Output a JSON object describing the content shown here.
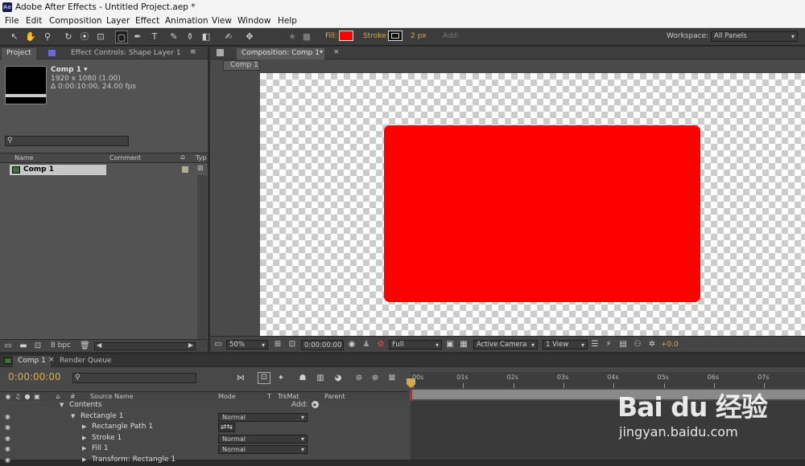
{
  "window": {
    "title": "Adobe After Effects - Untitled Project.aep *",
    "app_icon": "Ae"
  },
  "menu": [
    "File",
    "Edit",
    "Composition",
    "Layer",
    "Effect",
    "Animation",
    "View",
    "Window",
    "Help"
  ],
  "toolbar": {
    "fill_label": "Fill:",
    "fill_color": "#ff0000",
    "stroke_label": "Stroke:",
    "stroke_width": "2 px",
    "add_label": "Add:",
    "workspace_label": "Workspace:",
    "workspace_value": "All Panels"
  },
  "project_panel": {
    "tabs": [
      "Project",
      "Effect Controls: Shape Layer 1"
    ],
    "comp_name": "Comp 1 ▾",
    "comp_size": "1920 x 1080 (1.00)",
    "comp_duration": "Δ 0:00:10:00, 24.00 fps",
    "columns": {
      "name": "Name",
      "comment": "Comment",
      "type": "Typ"
    },
    "items": [
      {
        "name": "Comp 1"
      }
    ],
    "bpc": "8 bpc"
  },
  "comp_panel": {
    "tab": "Composition: Comp 1",
    "sub_tab": "Comp 1",
    "shape_color": "#ff0000",
    "zoom": "50%",
    "timecode": "0:00:00:00",
    "resolution": "Full",
    "camera": "Active Camera",
    "views": "1 View",
    "exposure": "+0.0"
  },
  "timeline": {
    "tabs": [
      "Comp 1",
      "Render Queue"
    ],
    "timecode": "0:00:00:00",
    "columns": {
      "source": "Source Name",
      "mode": "Mode",
      "t": "T",
      "trkmat": "TrkMat",
      "parent": "Parent"
    },
    "ruler": [
      "00s",
      "01s",
      "02s",
      "03s",
      "04s",
      "05s",
      "06s",
      "07s"
    ],
    "add_label": "Add:",
    "layers": [
      {
        "indent": 1,
        "name": "Contents",
        "mode": ""
      },
      {
        "indent": 2,
        "name": "Rectangle 1",
        "mode": "Normal"
      },
      {
        "indent": 3,
        "name": "Rectangle Path 1",
        "mode": ""
      },
      {
        "indent": 3,
        "name": "Stroke 1",
        "mode": "Normal"
      },
      {
        "indent": 3,
        "name": "Fill 1",
        "mode": "Normal"
      },
      {
        "indent": 3,
        "name": "Transform: Rectangle 1",
        "mode": ""
      }
    ]
  },
  "watermark": {
    "brand": "Bai du 经验",
    "url": "jingyan.baidu.com"
  }
}
